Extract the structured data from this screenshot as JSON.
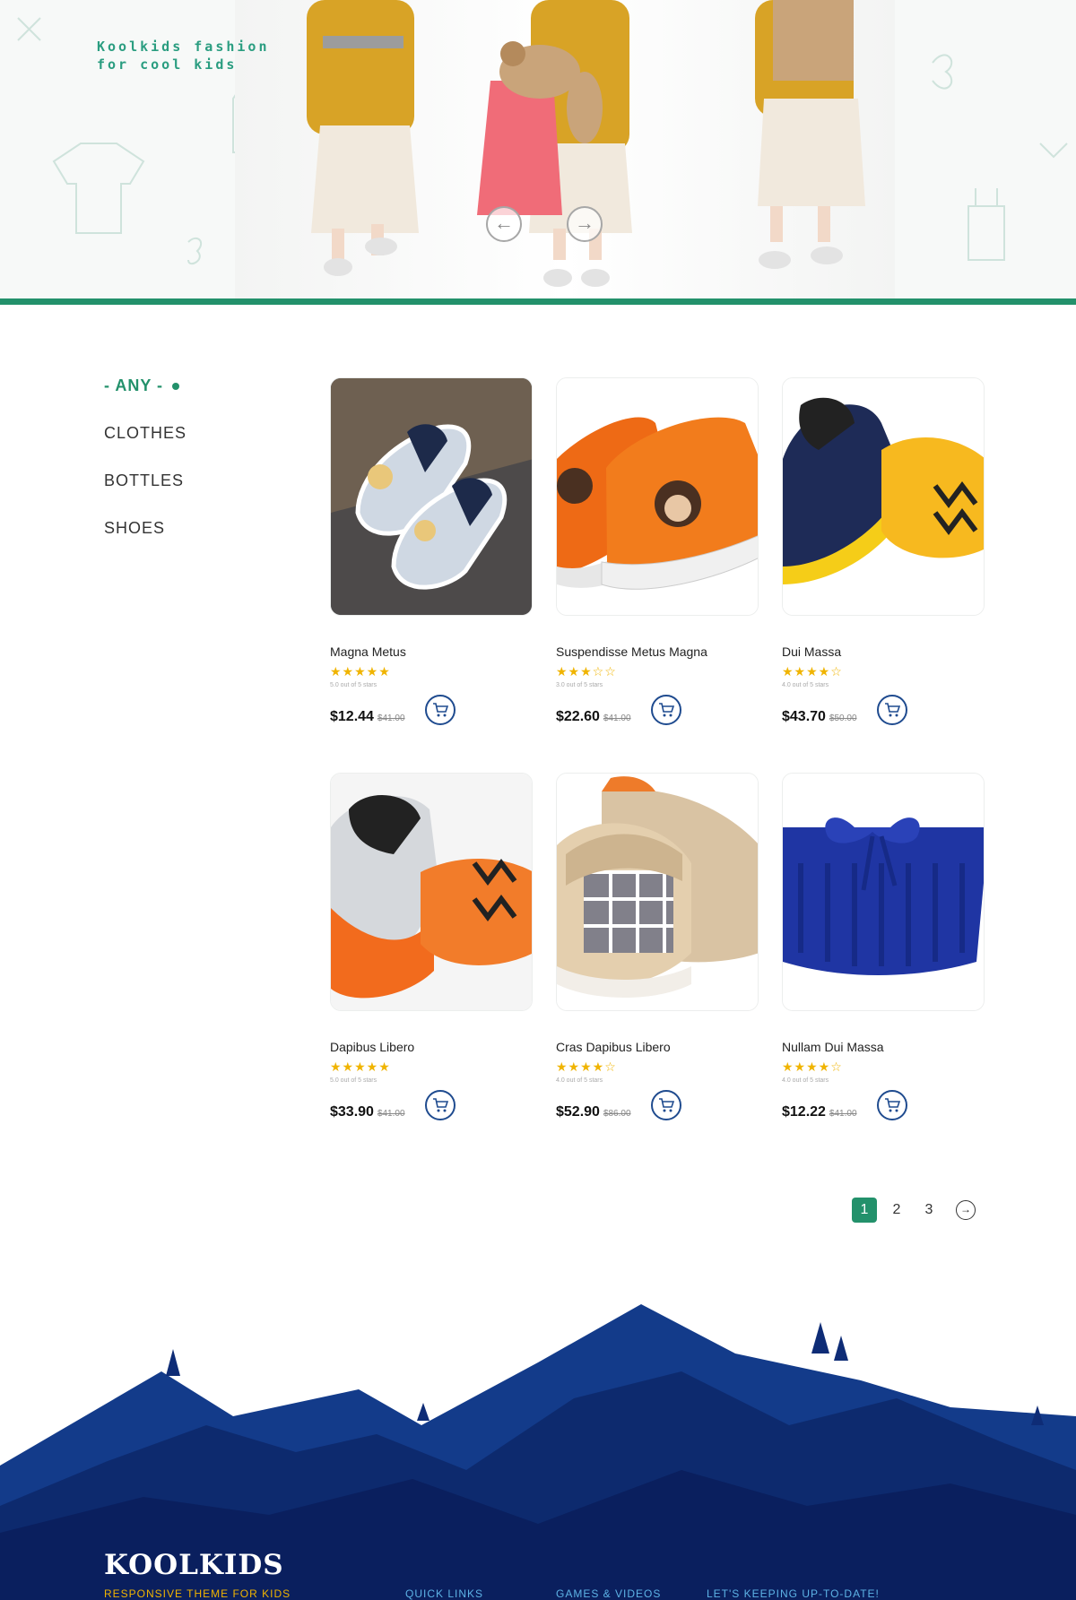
{
  "hero": {
    "tagline_line1": "Koolkids fashion",
    "tagline_line2": "for cool kids",
    "prev_icon": "arrow-left-icon",
    "next_icon": "arrow-right-icon"
  },
  "colors": {
    "accent": "#23916b",
    "star": "#f0b400",
    "cart": "#1f4b8f",
    "footer_dark": "#0a1f5e",
    "footer_mid": "#133b8a"
  },
  "filters": [
    {
      "label": "- ANY -",
      "active": true
    },
    {
      "label": "CLOTHES",
      "active": false
    },
    {
      "label": "BOTTLES",
      "active": false
    },
    {
      "label": "SHOES",
      "active": false
    }
  ],
  "products": [
    {
      "name": "Magna Metus",
      "price": "$12.44",
      "old_price": "$41.00",
      "rating": 5,
      "rating_text": "5.0 out of 5 stars",
      "image": "grey-slip-on-shoes"
    },
    {
      "name": "Suspendisse Metus Magna",
      "price": "$22.60",
      "old_price": "$41.00",
      "rating": 3,
      "rating_text": "3.0 out of 5 stars",
      "image": "orange-monkey-sneakers"
    },
    {
      "name": "Dui Massa",
      "price": "$43.70",
      "old_price": "$50.00",
      "rating": 4,
      "rating_text": "4.0 out of 5 stars",
      "image": "navy-yellow-sneakers"
    },
    {
      "name": "Dapibus Libero",
      "price": "$33.90",
      "old_price": "$41.00",
      "rating": 5,
      "rating_text": "5.0 out of 5 stars",
      "image": "orange-grey-sneakers"
    },
    {
      "name": "Cras Dapibus Libero",
      "price": "$52.90",
      "old_price": "$86.00",
      "rating": 4,
      "rating_text": "4.0 out of 5 stars",
      "image": "beige-plaid-sneakers"
    },
    {
      "name": "Nullam Dui Massa",
      "price": "$12.22",
      "old_price": "$41.00",
      "rating": 4,
      "rating_text": "4.0 out of 5 stars",
      "image": "blue-pleated-skirt"
    }
  ],
  "pagination": {
    "pages": [
      "1",
      "2",
      "3"
    ],
    "current": "1",
    "next_icon": "arrow-circle-right-icon"
  },
  "footer": {
    "brand": "KOOLKIDS",
    "subtitle": "RESPONSIVE THEME FOR KIDS",
    "links": [
      "QUICK LINKS",
      "GAMES & VIDEOS",
      "LET'S KEEPING UP-TO-DATE!"
    ]
  }
}
